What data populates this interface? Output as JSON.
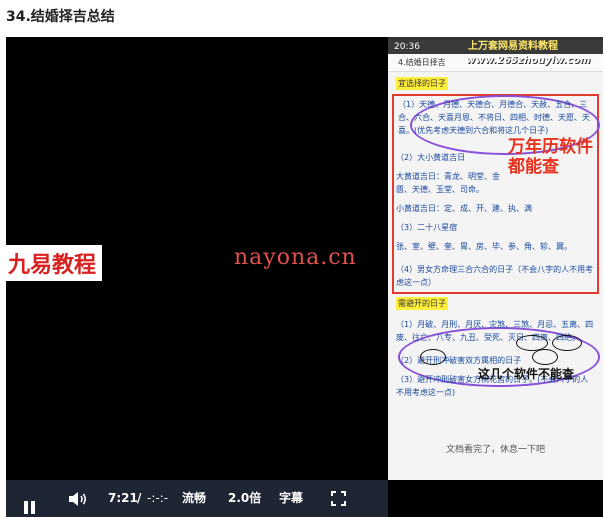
{
  "page": {
    "title": "34.结婚择吉总结"
  },
  "watermarks": {
    "left": "九易教程",
    "center": "nayona.cn"
  },
  "phone": {
    "status_time": "20:36",
    "status_site": "上万套网易资料教程",
    "site_url": "www.265zhouyiw.com",
    "doc_title": "4.结婚日择吉",
    "section1_heading": "宜选择的日子",
    "item1_text": "（1）天德、月德、天德合、月德合、天赦、五合、三合、六合、天喜月恩、不将日、四相、时德、天愿、天喜。(优先考虑天德到六合和将这几个日子)",
    "item2_title": "（2）大小黄道吉日",
    "item2_big": "大黄道吉日：青龙、明堂、金匮、天德、玉堂、司命。",
    "item2_small": "小黄道吉日：定、成、开、建、执、满",
    "item3_title": "（3）二十八星宿",
    "item3_text": "张、室、壁、奎、胃、房、毕、参、角、轸、翼。",
    "item4_text": "（4）男女方命理三合六合的日子（不会八字的人不用考虑这一点）",
    "section2_heading": "需避开的日子",
    "avoid1_text": "（1）月破、月刑、月厌、灾煞、三煞、月忌、五离、四废、往亡、八专、九丑、受死、灭日、四离、四绝。",
    "avoid2_text": "（2）避开刑冲破害双方属相的日子",
    "avoid3_text": "（3）避开冲刑破害女方桃花宫的日子。(不会八字的人不用考虑这一点)",
    "annotation_red": "万年历软件都能查",
    "annotation_black": "这几个软件不能查",
    "footer_text": "文档看完了，休息一下吧"
  },
  "controls": {
    "current_time": "7:21",
    "separator": "/",
    "duration": "-:-:-",
    "quality": "流畅",
    "speed": "2.0倍",
    "subtitle": "字幕"
  }
}
